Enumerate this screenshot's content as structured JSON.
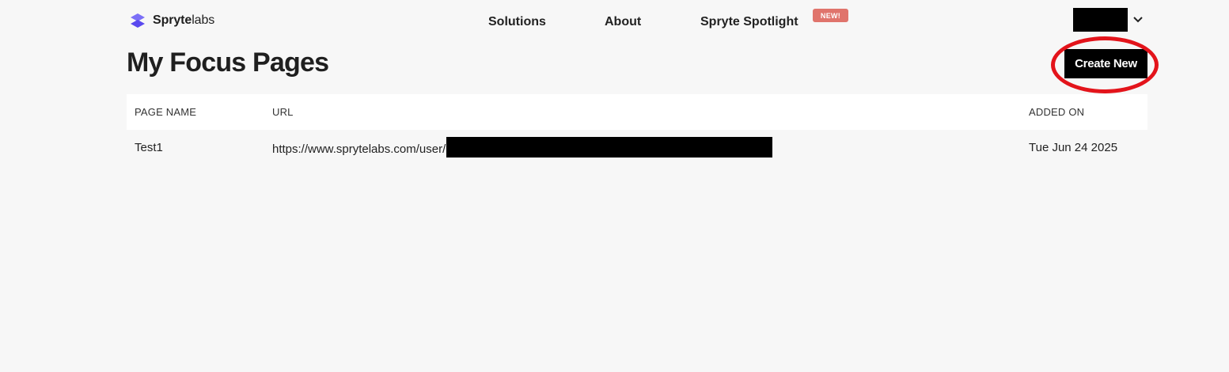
{
  "header": {
    "logo": {
      "bold": "Spryte",
      "light": "labs",
      "icon": "spryte-s-logo-icon",
      "brand_color": "#6a5cf6"
    },
    "nav": [
      {
        "label": "Solutions"
      },
      {
        "label": "About"
      },
      {
        "label": "Spryte Spotlight",
        "badge": "NEW!"
      }
    ],
    "user_menu": {
      "icon": "chevron-down-icon"
    }
  },
  "main": {
    "title": "My Focus Pages",
    "create_button": "Create New",
    "highlight_color": "#e3141b",
    "table": {
      "columns": [
        "PAGE NAME",
        "URL",
        "ADDED ON"
      ],
      "rows": [
        {
          "name": "Test1",
          "url": "https://www.sprytelabs.com/user/",
          "added_on": "Tue Jun 24 2025"
        }
      ]
    }
  }
}
